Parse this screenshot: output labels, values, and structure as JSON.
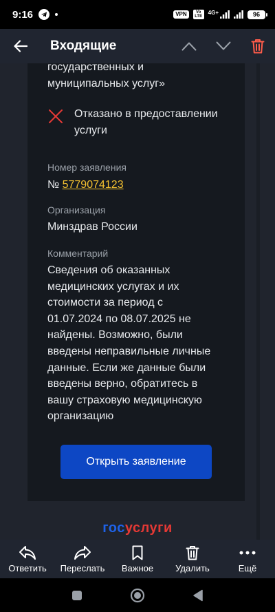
{
  "status_bar": {
    "time": "9:16",
    "vpn": "VPN",
    "volte": "Vo LTE",
    "network": "4G+",
    "battery": "96"
  },
  "header": {
    "title": "Входящие"
  },
  "message": {
    "service_name": "государственных и\nмуниципальных услуг»",
    "status": "Отказано в предоставлении услуги",
    "application_number_label": "Номер заявления",
    "application_number_prefix": "№ ",
    "application_number": "5779074123",
    "organization_label": "Организация",
    "organization": "Минздрав России",
    "comment_label": "Комментарий",
    "comment": "Сведения об оказанных медицинских услугах и их стоимости за период с 01.07.2024 по 08.07.2025 не найдены. Возможно, были введены неправильные личные данные. Если же данные были введены верно, обратитесь в вашу страховую медицинскую организацию",
    "open_button": "Открыть заявление"
  },
  "logo": {
    "part1": "гос",
    "part2": "услуги"
  },
  "actions": {
    "reply": "Ответить",
    "forward": "Переслать",
    "important": "Важное",
    "delete": "Удалить",
    "more": "Ещё"
  },
  "colors": {
    "accent_link": "#f5c230",
    "danger": "#ff5c4a",
    "primary_button": "#0d47c4",
    "status_reject": "#e53935"
  }
}
